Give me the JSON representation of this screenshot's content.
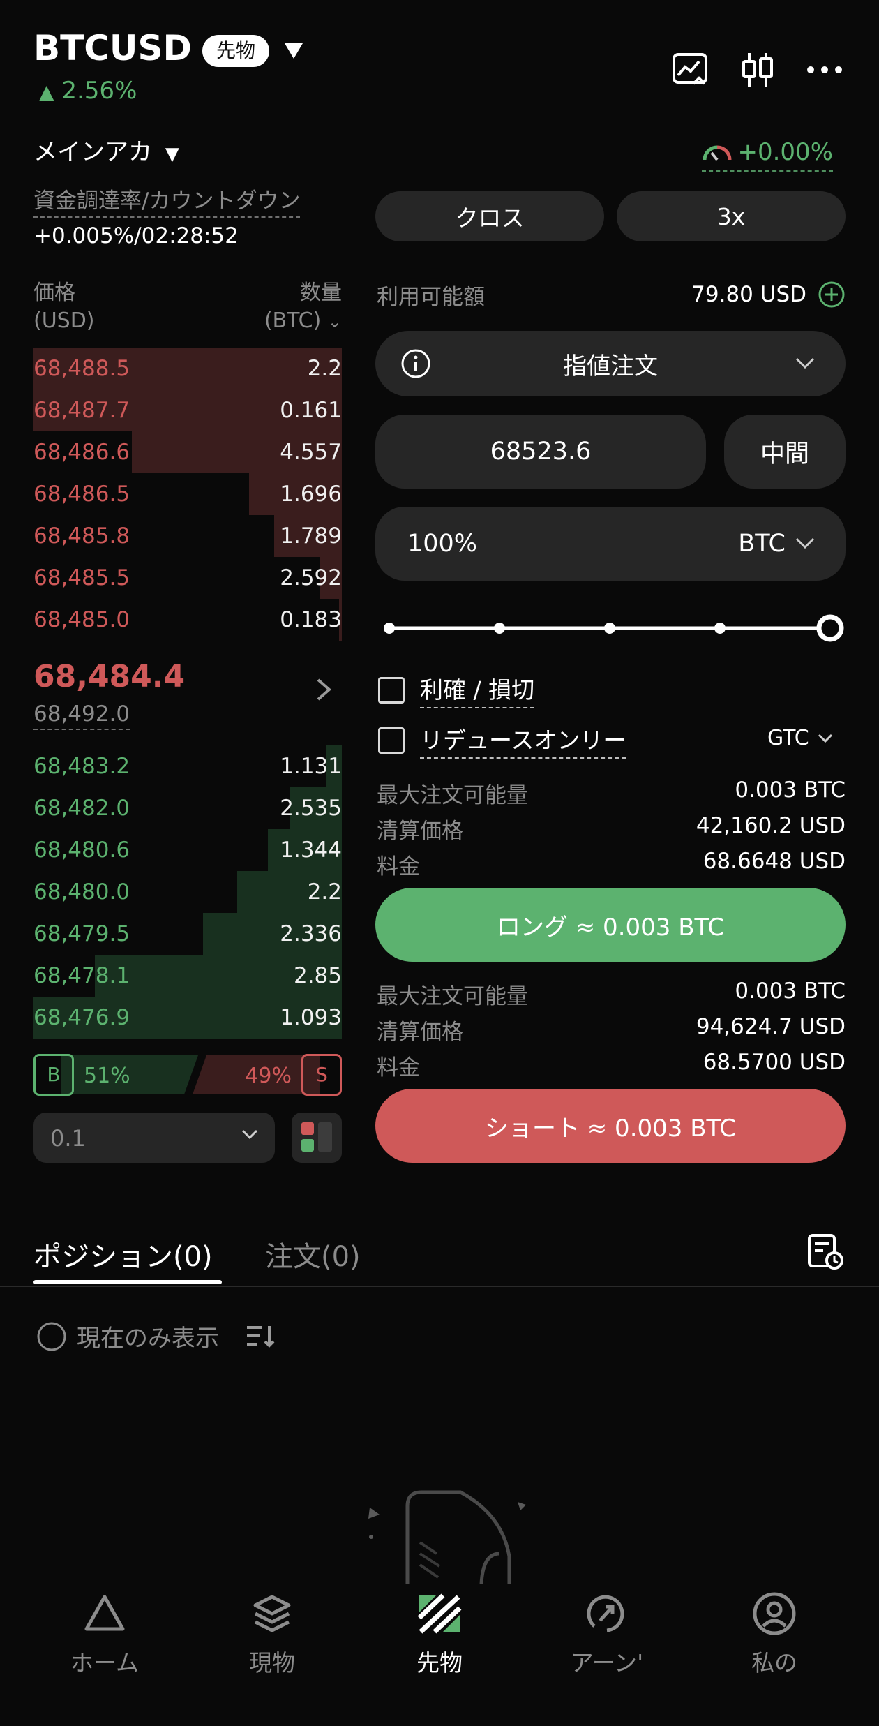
{
  "header": {
    "symbol": "BTCUSD",
    "badge": "先物",
    "change": "2.56%",
    "icons": [
      "chart-icon",
      "candlestick-icon",
      "more-icon"
    ]
  },
  "account": {
    "name": "メインアカ",
    "gauge_value": "+0.00%",
    "funding_label": "資金調達率/カウントダウン",
    "funding_value": "+0.005%/02:28:52"
  },
  "margin": {
    "mode": "クロス",
    "leverage": "3x"
  },
  "orderbook": {
    "price_header": "価格",
    "price_unit": "(USD)",
    "qty_header": "数量",
    "qty_unit": "(BTC)",
    "asks": [
      {
        "price": "68,488.5",
        "qty": "2.2",
        "depth": 1.0
      },
      {
        "price": "68,487.7",
        "qty": "0.161",
        "depth": 1.0
      },
      {
        "price": "68,486.6",
        "qty": "4.557",
        "depth": 0.68
      },
      {
        "price": "68,486.5",
        "qty": "1.696",
        "depth": 0.3
      },
      {
        "price": "68,485.8",
        "qty": "1.789",
        "depth": 0.22
      },
      {
        "price": "68,485.5",
        "qty": "2.592",
        "depth": 0.07
      },
      {
        "price": "68,485.0",
        "qty": "0.183",
        "depth": 0.01
      }
    ],
    "last_price": "68,484.4",
    "mark_price": "68,492.0",
    "bids": [
      {
        "price": "68,483.2",
        "qty": "1.131",
        "depth": 0.05
      },
      {
        "price": "68,482.0",
        "qty": "2.535",
        "depth": 0.17
      },
      {
        "price": "68,480.6",
        "qty": "1.344",
        "depth": 0.24
      },
      {
        "price": "68,480.0",
        "qty": "2.2",
        "depth": 0.34
      },
      {
        "price": "68,479.5",
        "qty": "2.336",
        "depth": 0.45
      },
      {
        "price": "68,478.1",
        "qty": "2.85",
        "depth": 0.8
      },
      {
        "price": "68,476.9",
        "qty": "1.093",
        "depth": 1.0
      }
    ],
    "buy_label": "B",
    "buy_pct": "51%",
    "sell_pct": "49%",
    "sell_label": "S",
    "precision": "0.1"
  },
  "order": {
    "available_label": "利用可能額",
    "available_value": "79.80 USD",
    "type": "指値注文",
    "price": "68523.6",
    "mid_label": "中間",
    "quantity": "100%",
    "quantity_unit": "BTC",
    "slider_level": 1.0,
    "tp_sl_label": "利確 / 損切",
    "reduce_only_label": "リデュースオンリー",
    "tif": "GTC",
    "long": {
      "max_label": "最大注文可能量",
      "max_value": "0.003 BTC",
      "liq_label": "清算価格",
      "liq_value": "42,160.2 USD",
      "fee_label": "料金",
      "fee_value": "68.6648 USD",
      "button": "ロング ≈ 0.003 BTC"
    },
    "short": {
      "max_label": "最大注文可能量",
      "max_value": "0.003 BTC",
      "liq_label": "清算価格",
      "liq_value": "94,624.7 USD",
      "fee_label": "料金",
      "fee_value": "68.5700 USD",
      "button": "ショート ≈ 0.003 BTC"
    }
  },
  "tabs": {
    "positions": "ポジション(0)",
    "orders": "注文(0)",
    "current_only": "現在のみ表示"
  },
  "nav": {
    "home": "ホーム",
    "spot": "現物",
    "futures": "先物",
    "earn": "アーン'",
    "me": "私の"
  },
  "colors": {
    "up": "#5cb26f",
    "down": "#cf5959",
    "ask_bg": "#3a1d1d",
    "bid_bg": "#18301f",
    "pill": "#262626"
  }
}
